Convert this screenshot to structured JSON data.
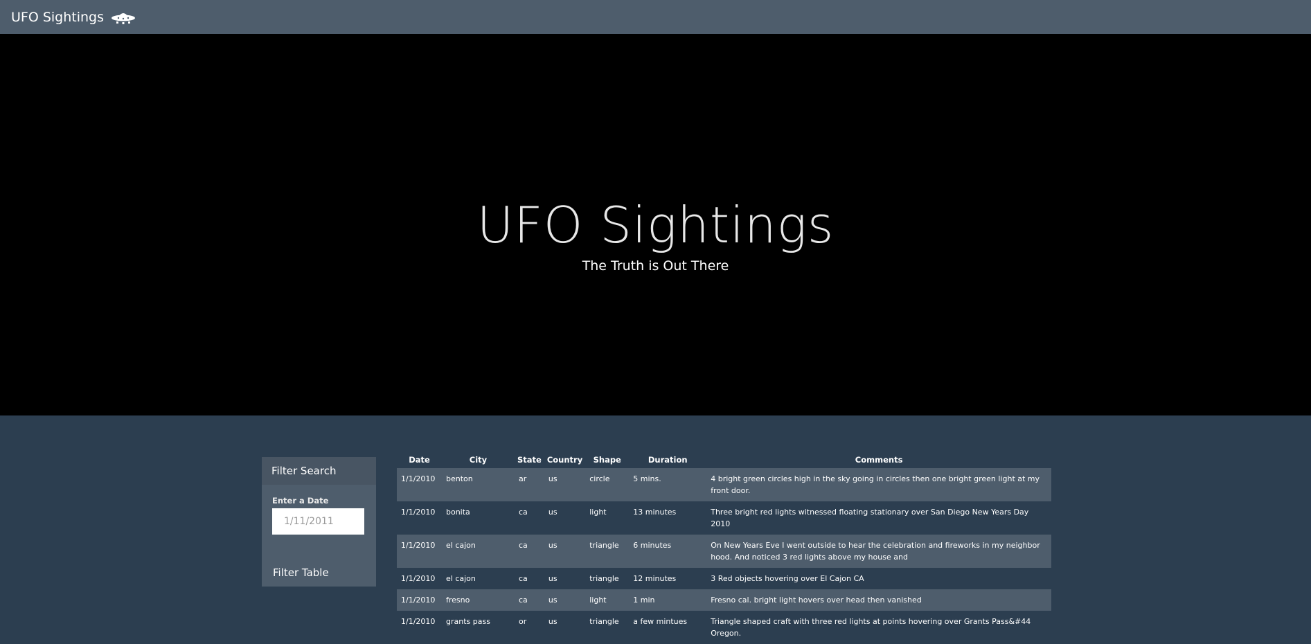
{
  "navbar": {
    "brand": "UFO Sightings",
    "icon": "ufo-icon"
  },
  "hero": {
    "title": "UFO Sightings",
    "subtitle": "The Truth is Out There"
  },
  "filter": {
    "header": "Filter Search",
    "label": "Enter a Date",
    "placeholder": "1/11/2011",
    "button": "Filter Table"
  },
  "table": {
    "headers": [
      "Date",
      "City",
      "State",
      "Country",
      "Shape",
      "Duration",
      "Comments"
    ],
    "rows": [
      {
        "date": "1/1/2010",
        "city": "benton",
        "state": "ar",
        "country": "us",
        "shape": "circle",
        "duration": "5 mins.",
        "comments": "4 bright green circles high in the sky going in circles then one bright green light at my front door."
      },
      {
        "date": "1/1/2010",
        "city": "bonita",
        "state": "ca",
        "country": "us",
        "shape": "light",
        "duration": "13 minutes",
        "comments": "Three bright red lights witnessed floating stationary over San Diego New Years Day 2010"
      },
      {
        "date": "1/1/2010",
        "city": "el cajon",
        "state": "ca",
        "country": "us",
        "shape": "triangle",
        "duration": "6 minutes",
        "comments": "On New Years Eve I went outside to hear the celebration and fireworks in my neighbor hood. And noticed 3 red lights above my house and"
      },
      {
        "date": "1/1/2010",
        "city": "el cajon",
        "state": "ca",
        "country": "us",
        "shape": "triangle",
        "duration": "12 minutes",
        "comments": "3 Red objects hovering over El Cajon CA"
      },
      {
        "date": "1/1/2010",
        "city": "fresno",
        "state": "ca",
        "country": "us",
        "shape": "light",
        "duration": "1 min",
        "comments": "Fresno cal. bright light hovers over head then vanished"
      },
      {
        "date": "1/1/2010",
        "city": "grants pass",
        "state": "or",
        "country": "us",
        "shape": "triangle",
        "duration": "a few mintues",
        "comments": "Triangle shaped craft with three red lights at points hovering over Grants Pass&#44 Oregon."
      }
    ]
  }
}
